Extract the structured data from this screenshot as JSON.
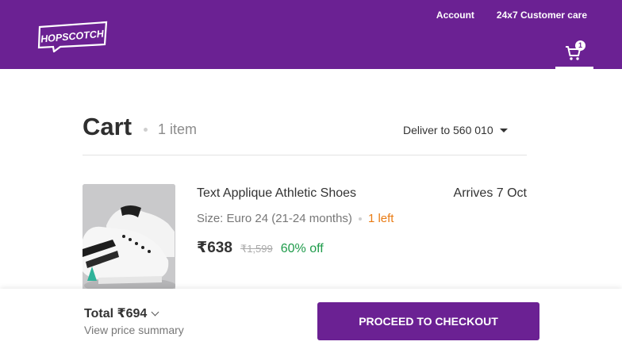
{
  "header": {
    "brand": "HOPSCOTCH",
    "links": [
      "Account",
      "24x7 Customer care"
    ],
    "cart_count": "1",
    "background": "#6b2193"
  },
  "cart": {
    "title": "Cart",
    "item_count": "1 item",
    "deliver_to": "Deliver to 560 010"
  },
  "item": {
    "name": "Text Applique Athletic Shoes",
    "arrives": "Arrives 7 Oct",
    "size": "Size: Euro 24 (21-24 months)",
    "stock": "1 left",
    "price": "₹638",
    "mrp": "₹1,599",
    "discount": "60% off",
    "image_icon": "sneaker-photo"
  },
  "footer": {
    "total": "Total ₹694",
    "summary_link": "View price summary",
    "checkout_label": "PROCEED TO CHECKOUT"
  },
  "colors": {
    "accent": "#6b2193",
    "stock_warning": "#e97b13",
    "discount": "#1e9b4a"
  }
}
